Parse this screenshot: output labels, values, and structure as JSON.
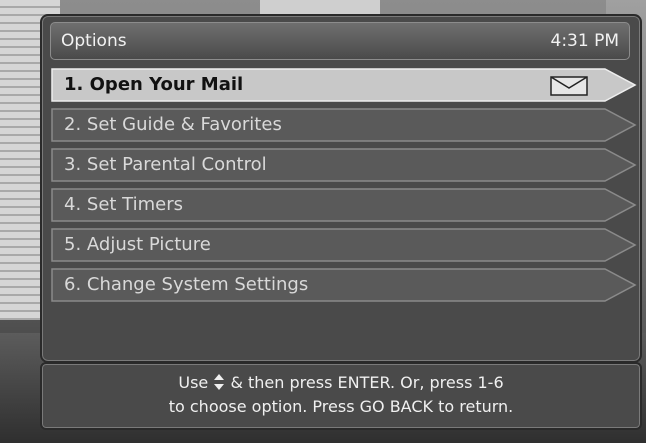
{
  "header": {
    "title": "Options",
    "time": "4:31 PM"
  },
  "menu": {
    "selected_index": 0,
    "items": [
      {
        "label": "1.  Open Your Mail",
        "icon": "mail-envelope-icon"
      },
      {
        "label": "2.  Set Guide & Favorites"
      },
      {
        "label": "3.  Set Parental Control"
      },
      {
        "label": "4.  Set Timers"
      },
      {
        "label": "5.  Adjust Picture"
      },
      {
        "label": "6.  Change System Settings"
      }
    ]
  },
  "help": {
    "line1_before_icon": "Use",
    "arrows_icon": "up-down-arrows-icon",
    "line1_after_icon": "& then press ENTER.  Or, press 1-6",
    "line2": "to choose option.  Press GO BACK to return."
  },
  "colors": {
    "panel": "#4a4a4a",
    "item_normal": "#5a5a5a",
    "item_selected": "#c8c8c8",
    "text_light": "#f2f2f2",
    "text_selected": "#111111"
  }
}
